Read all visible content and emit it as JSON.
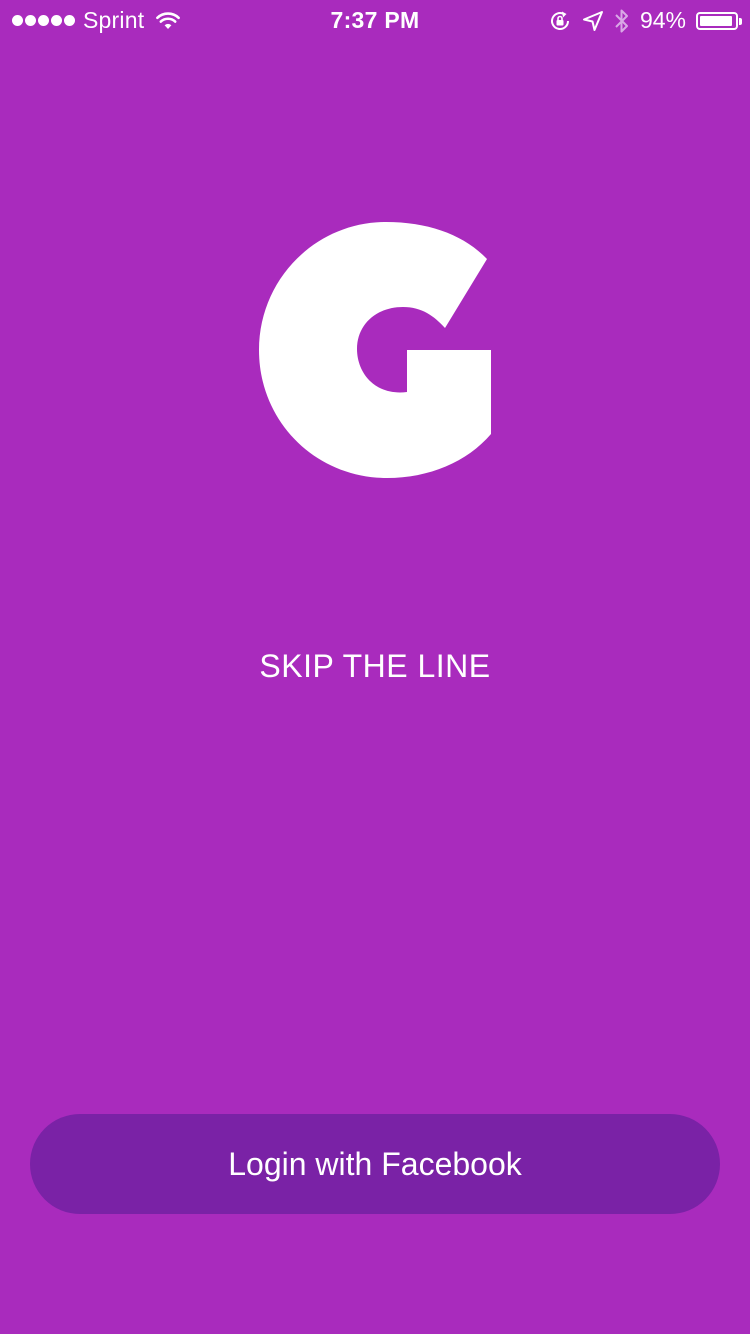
{
  "status_bar": {
    "carrier": "Sprint",
    "time": "7:37 PM",
    "battery_percent": "94%",
    "battery_level": 0.94,
    "signal_bars": 5,
    "icons": [
      "signal-dots-icon",
      "wifi-icon",
      "rotation-lock-icon",
      "location-arrow-icon",
      "bluetooth-icon",
      "battery-icon"
    ]
  },
  "logo": {
    "icon": "g-logo-icon"
  },
  "main": {
    "tagline": "SKIP THE LINE"
  },
  "login": {
    "facebook_label": "Login with Facebook"
  },
  "colors": {
    "background": "#a92bbd",
    "button": "#7a22a6",
    "text": "#ffffff"
  }
}
